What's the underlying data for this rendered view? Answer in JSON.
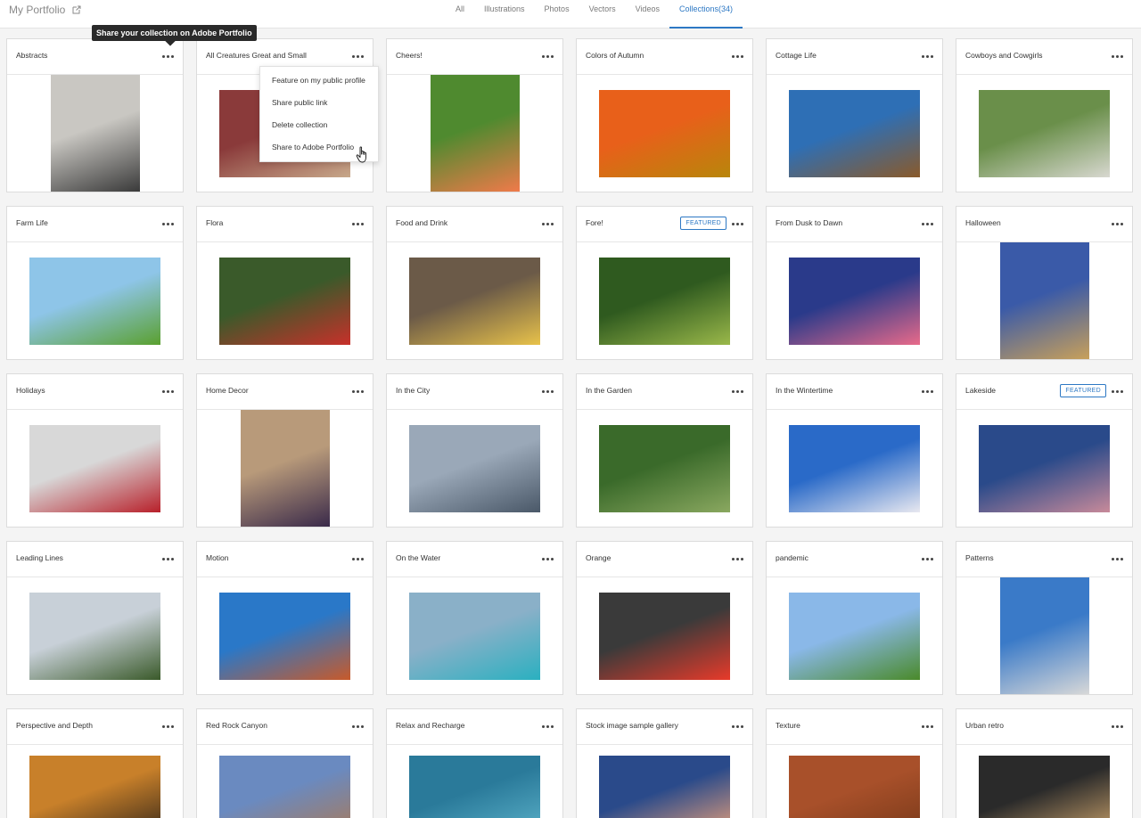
{
  "header": {
    "title": "My Portfolio",
    "tabs": [
      {
        "label": "All",
        "active": false
      },
      {
        "label": "Illustrations",
        "active": false
      },
      {
        "label": "Photos",
        "active": false
      },
      {
        "label": "Vectors",
        "active": false
      },
      {
        "label": "Videos",
        "active": false
      },
      {
        "label": "Collections(34)",
        "active": true
      }
    ]
  },
  "tooltip": "Share your collection on Adobe Portfolio",
  "menu": {
    "items": [
      "Feature on my public profile",
      "Share public link",
      "Delete collection",
      "Share to Adobe Portfolio"
    ]
  },
  "featured_label": "FEATURED",
  "collections": [
    {
      "title": "Abstracts",
      "thumb": "portrait",
      "colors": [
        "#c9c7c2",
        "#3a3a3a"
      ]
    },
    {
      "title": "All Creatures Great and Small",
      "thumb": "landscape",
      "colors": [
        "#8a3a3a",
        "#c7a88a"
      ]
    },
    {
      "title": "Cheers!",
      "thumb": "portrait",
      "colors": [
        "#4f8a2f",
        "#f07a4a"
      ]
    },
    {
      "title": "Colors of Autumn",
      "thumb": "landscape",
      "colors": [
        "#e8601a",
        "#b8860b"
      ]
    },
    {
      "title": "Cottage Life",
      "thumb": "landscape",
      "colors": [
        "#2e6fb5",
        "#8a5a2a"
      ]
    },
    {
      "title": "Cowboys and Cowgirls",
      "thumb": "landscape",
      "colors": [
        "#6a8f4a",
        "#d8d8d0"
      ]
    },
    {
      "title": "Farm Life",
      "thumb": "landscape",
      "colors": [
        "#8ec5e8",
        "#5aa02f"
      ]
    },
    {
      "title": "Flora",
      "thumb": "landscape",
      "colors": [
        "#3a5a2a",
        "#c8302a"
      ]
    },
    {
      "title": "Food and Drink",
      "thumb": "landscape",
      "colors": [
        "#6b5a48",
        "#e8c24a"
      ]
    },
    {
      "title": "Fore!",
      "thumb": "landscape",
      "colors": [
        "#2f5a1f",
        "#9ab84a"
      ],
      "featured": true
    },
    {
      "title": "From Dusk to Dawn",
      "thumb": "landscape",
      "colors": [
        "#2a3a8a",
        "#e86a8a"
      ]
    },
    {
      "title": "Halloween",
      "thumb": "portrait",
      "colors": [
        "#3a5aa8",
        "#c8a05a"
      ]
    },
    {
      "title": "Holidays",
      "thumb": "landscape",
      "colors": [
        "#d8d8d8",
        "#b8202a"
      ]
    },
    {
      "title": "Home Decor",
      "thumb": "portrait",
      "colors": [
        "#b89a7a",
        "#3a2a4a"
      ]
    },
    {
      "title": "In the City",
      "thumb": "landscape",
      "colors": [
        "#9aa8b8",
        "#4a5868"
      ]
    },
    {
      "title": "In the Garden",
      "thumb": "landscape",
      "colors": [
        "#3a6a2a",
        "#8aa860"
      ]
    },
    {
      "title": "In the Wintertime",
      "thumb": "landscape",
      "colors": [
        "#2a6ac8",
        "#e8e8f0"
      ]
    },
    {
      "title": "Lakeside",
      "thumb": "landscape",
      "colors": [
        "#2a4a8a",
        "#c88a9a"
      ],
      "featured": true
    },
    {
      "title": "Leading Lines",
      "thumb": "landscape",
      "colors": [
        "#c8d0d8",
        "#3a5a2a"
      ]
    },
    {
      "title": "Motion",
      "thumb": "landscape",
      "colors": [
        "#2a78c8",
        "#c85a2a"
      ]
    },
    {
      "title": "On the Water",
      "thumb": "landscape",
      "colors": [
        "#8ab0c8",
        "#2ab0c0"
      ]
    },
    {
      "title": "Orange",
      "thumb": "landscape",
      "colors": [
        "#3a3a3a",
        "#e83a2a"
      ]
    },
    {
      "title": "pandemic",
      "thumb": "landscape",
      "colors": [
        "#8ab8e8",
        "#4a8a2a"
      ]
    },
    {
      "title": "Patterns",
      "thumb": "portrait",
      "colors": [
        "#3a7ac8",
        "#d8d8d8"
      ]
    },
    {
      "title": "Perspective and Depth",
      "thumb": "landscape",
      "colors": [
        "#c8802a",
        "#3a2a1a"
      ]
    },
    {
      "title": "Red Rock Canyon",
      "thumb": "landscape",
      "colors": [
        "#6a8ac0",
        "#a87a5a"
      ]
    },
    {
      "title": "Relax and Recharge",
      "thumb": "landscape",
      "colors": [
        "#2a7a9a",
        "#5ab0c8"
      ]
    },
    {
      "title": "Stock image sample gallery",
      "thumb": "landscape",
      "colors": [
        "#2a4a8a",
        "#e8a07a"
      ]
    },
    {
      "title": "Texture",
      "thumb": "landscape",
      "colors": [
        "#a8502a",
        "#7a3a1a"
      ]
    },
    {
      "title": "Urban retro",
      "thumb": "landscape",
      "colors": [
        "#2a2a2a",
        "#c8a06a"
      ]
    }
  ]
}
